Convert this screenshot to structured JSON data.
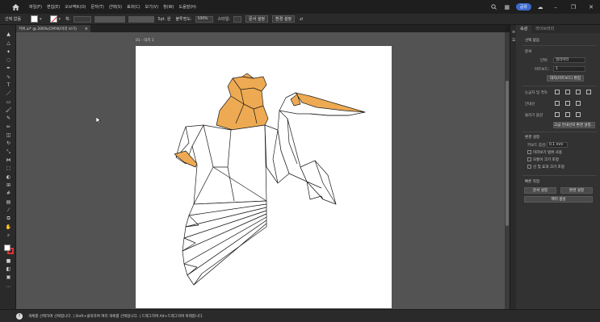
{
  "menubar": {
    "items": [
      "파일(F)",
      "편집(E)",
      "오브젝트(O)",
      "문자(T)",
      "선택(S)",
      "효과(C)",
      "보기(V)",
      "창(W)",
      "도움말(H)"
    ],
    "share_label": "공유",
    "window_controls": [
      "minimize-icon",
      "restore-icon",
      "close-icon"
    ]
  },
  "controlbar": {
    "selection_label": "선택 없음",
    "stroke_label": "획:",
    "brush_label": "5pt. 원",
    "opacity_label": "불투명도:",
    "opacity_value": "100%",
    "style_label": "스타일:",
    "doc_setup_label": "문서 설정",
    "prefs_label": "환경 설정"
  },
  "document": {
    "tab_title": "키위.ai* @ 200%(CMYK/미리 보기)",
    "artboard_label": "01 - 대지 1",
    "tab_close": "×"
  },
  "panel": {
    "tabs": [
      "속성",
      "라이브러리"
    ],
    "active_tab": "속성",
    "no_selection": "선택 없음",
    "doc_section": "문서",
    "unit_label": "단위:",
    "unit_value": "밀리미터",
    "artboard_label": "아트보드:",
    "artboard_value": "1",
    "edit_artboard_btn": "대지(아트보드) 편집",
    "rulers_grid_label": "눈금자 및 격자",
    "guides_label": "안내선",
    "snap_label": "물리기 옵션",
    "guide_prefs_btn": "고급 안내선의 환경 설정...",
    "prefs_section": "환경 설정",
    "keyboard_inc_label": "키보드 증감:",
    "keyboard_inc_value": "0.1 mm",
    "checkboxes": [
      "미리보기 범위 사용",
      "모퉁이 크기 조정",
      "선 및 효과 크기 조정"
    ],
    "quick_actions_section": "빠른 작업",
    "doc_setup_btn": "문서 설정",
    "prefs_btn": "환경 설정",
    "export_btn": "벡터 생성"
  },
  "statusbar": {
    "tip": "개체를 선택하여 선택합니다. | Shift+클릭하여 여러 개체를 선택합니다. | 드래그하여 Alt+드래그하여 복제합니다."
  },
  "colors": {
    "accent_orange": "#e8a04c",
    "canvas": "#535353",
    "panel": "#323232"
  }
}
